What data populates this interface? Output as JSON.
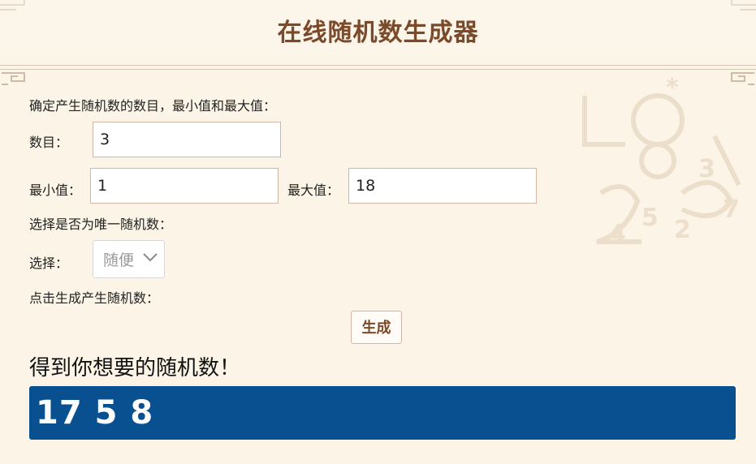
{
  "header": {
    "title": "在线随机数生成器"
  },
  "form": {
    "intro": "确定产生随机数的数目，最小值和最大值：",
    "count_label": "数目：",
    "count_value": "3",
    "min_label": "最小值：",
    "min_value": "1",
    "max_label": "最大值：",
    "max_value": "18",
    "unique_prompt": "选择是否为唯一随机数：",
    "select_label": "选择：",
    "select_value": "随便",
    "generate_prompt": "点击生成产生随机数：",
    "generate_button": "生成"
  },
  "result": {
    "title": "得到你想要的随机数！",
    "values": "17 5 8"
  },
  "colors": {
    "header_text": "#7b4a2a",
    "background": "#fcf5e7",
    "result_bg": "#08508f",
    "field_border": "#d4b6a7"
  },
  "icons": {
    "select_arrow": "chevron-down-icon",
    "decor": "ornament-corner"
  }
}
